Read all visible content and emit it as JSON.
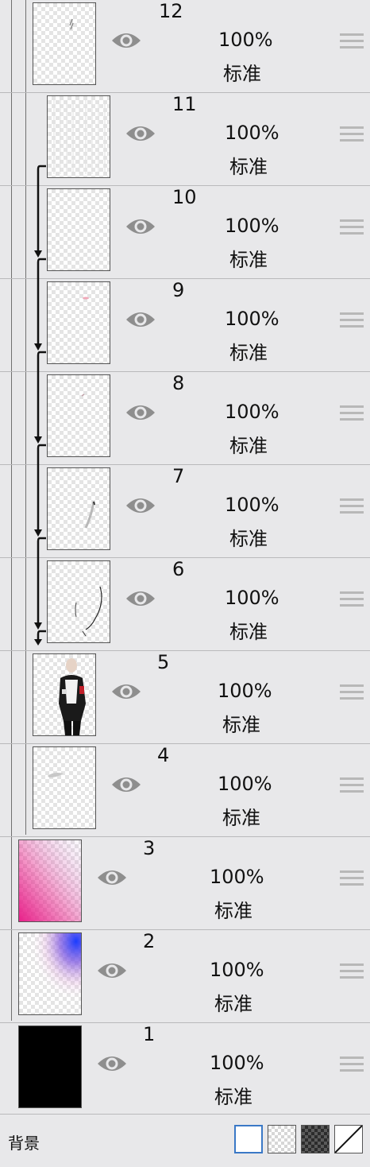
{
  "layers": [
    {
      "number": "12",
      "opacity": "100%",
      "blend_mode": "标准",
      "visible": true,
      "thumbnail": "faint-sketch"
    },
    {
      "number": "11",
      "opacity": "100%",
      "blend_mode": "标准",
      "visible": true,
      "thumbnail": "faint-hatch",
      "clipped": true
    },
    {
      "number": "10",
      "opacity": "100%",
      "blend_mode": "标准",
      "visible": true,
      "thumbnail": "empty",
      "clipped": true
    },
    {
      "number": "9",
      "opacity": "100%",
      "blend_mode": "标准",
      "visible": true,
      "thumbnail": "pink-dot",
      "clipped": true
    },
    {
      "number": "8",
      "opacity": "100%",
      "blend_mode": "标准",
      "visible": true,
      "thumbnail": "tiny-mark",
      "clipped": true
    },
    {
      "number": "7",
      "opacity": "100%",
      "blend_mode": "标准",
      "visible": true,
      "thumbnail": "grey-stroke",
      "clipped": true
    },
    {
      "number": "6",
      "opacity": "100%",
      "blend_mode": "标准",
      "visible": true,
      "thumbnail": "line-art",
      "clipped": true
    },
    {
      "number": "5",
      "opacity": "100%",
      "blend_mode": "标准",
      "visible": true,
      "thumbnail": "character-figure"
    },
    {
      "number": "4",
      "opacity": "100%",
      "blend_mode": "标准",
      "visible": true,
      "thumbnail": "grey-smudge"
    },
    {
      "number": "3",
      "opacity": "100%",
      "blend_mode": "标准",
      "visible": true,
      "thumbnail": "pink-gradient"
    },
    {
      "number": "2",
      "opacity": "100%",
      "blend_mode": "标准",
      "visible": true,
      "thumbnail": "blue-glow"
    },
    {
      "number": "1",
      "opacity": "100%",
      "blend_mode": "标准",
      "visible": true,
      "thumbnail": "black-fill"
    }
  ],
  "icons": {
    "visibility": "eye-icon",
    "drag": "drag-handle-icon",
    "clip": "clipping-arrow-icon"
  },
  "colors": {
    "panel_bg": "#e8e8ea",
    "eye": "#8e8e8e",
    "selected_outline": "#3a78c6",
    "pink": "#e8218a",
    "blue": "#1a3cff"
  },
  "footer": {
    "label": "背景",
    "options": [
      "white",
      "light-checker",
      "dark-checker",
      "none"
    ],
    "selected": "white"
  }
}
